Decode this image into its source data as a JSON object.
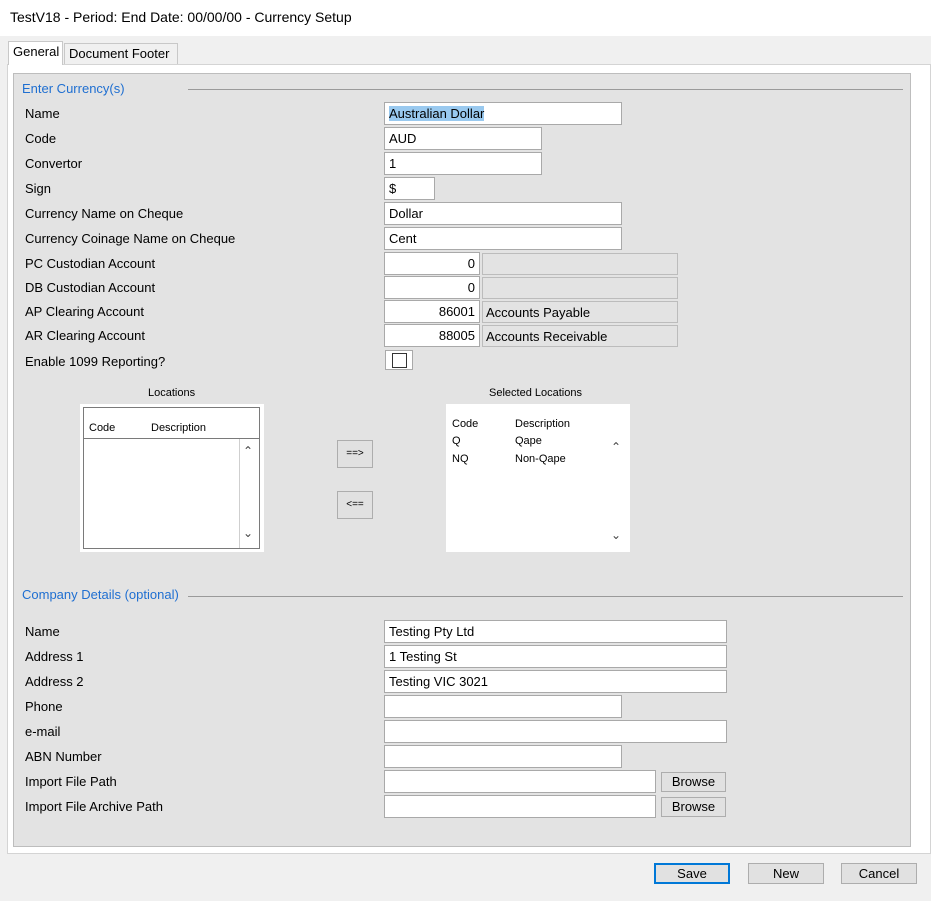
{
  "window": {
    "title": "TestV18  - Period:   End Date: 00/00/00 - Currency Setup"
  },
  "tabs": [
    {
      "label": "General",
      "active": true
    },
    {
      "label": "Document Footer",
      "active": false
    }
  ],
  "currency": {
    "section_title": "Enter Currency(s)",
    "name_label": "Name",
    "name_value": "Australian Dollar",
    "code_label": "Code",
    "code_value": "AUD",
    "convertor_label": "Convertor",
    "convertor_value": "1",
    "sign_label": "Sign",
    "sign_value": "$",
    "cheque_name_label": "Currency Name on Cheque",
    "cheque_name_value": "Dollar",
    "coinage_label": "Currency Coinage Name on Cheque",
    "coinage_value": "Cent",
    "pc_custodian_label": "PC Custodian Account",
    "pc_custodian_value": "0",
    "pc_custodian_desc": "",
    "db_custodian_label": "DB Custodian Account",
    "db_custodian_value": "0",
    "db_custodian_desc": "",
    "ap_clearing_label": "AP Clearing Account",
    "ap_clearing_value": "86001",
    "ap_clearing_desc": "Accounts Payable",
    "ar_clearing_label": "AR Clearing Account",
    "ar_clearing_value": "88005",
    "ar_clearing_desc": "Accounts Receivable",
    "enable_1099_label": "Enable 1099 Reporting?",
    "enable_1099_checked": false
  },
  "locations": {
    "caption": "Locations",
    "col_code": "Code",
    "col_description": "Description",
    "rows": []
  },
  "transfer": {
    "add_label": "==>",
    "remove_label": "<=="
  },
  "selected_locations": {
    "caption": "Selected Locations",
    "col_code": "Code",
    "col_description": "Description",
    "rows": [
      {
        "code": "Q",
        "description": "Qape"
      },
      {
        "code": "NQ",
        "description": "Non-Qape"
      }
    ]
  },
  "company": {
    "section_title": "Company Details (optional)",
    "name_label": "Name",
    "name_value": "Testing Pty Ltd",
    "address1_label": "Address 1",
    "address1_value": "1 Testing St",
    "address2_label": "Address 2",
    "address2_value": "Testing  VIC 3021",
    "phone_label": "Phone",
    "phone_value": "",
    "email_label": "e-mail",
    "email_value": "",
    "abn_label": "ABN Number",
    "abn_value": "",
    "import_path_label": "Import File Path",
    "import_path_value": "",
    "archive_path_label": "Import File Archive Path",
    "archive_path_value": "",
    "browse_label": "Browse"
  },
  "buttons": {
    "save": "Save",
    "new": "New",
    "cancel": "Cancel"
  },
  "icons": {
    "scroll_up": "chevron-up-icon",
    "scroll_down": "chevron-down-icon"
  }
}
